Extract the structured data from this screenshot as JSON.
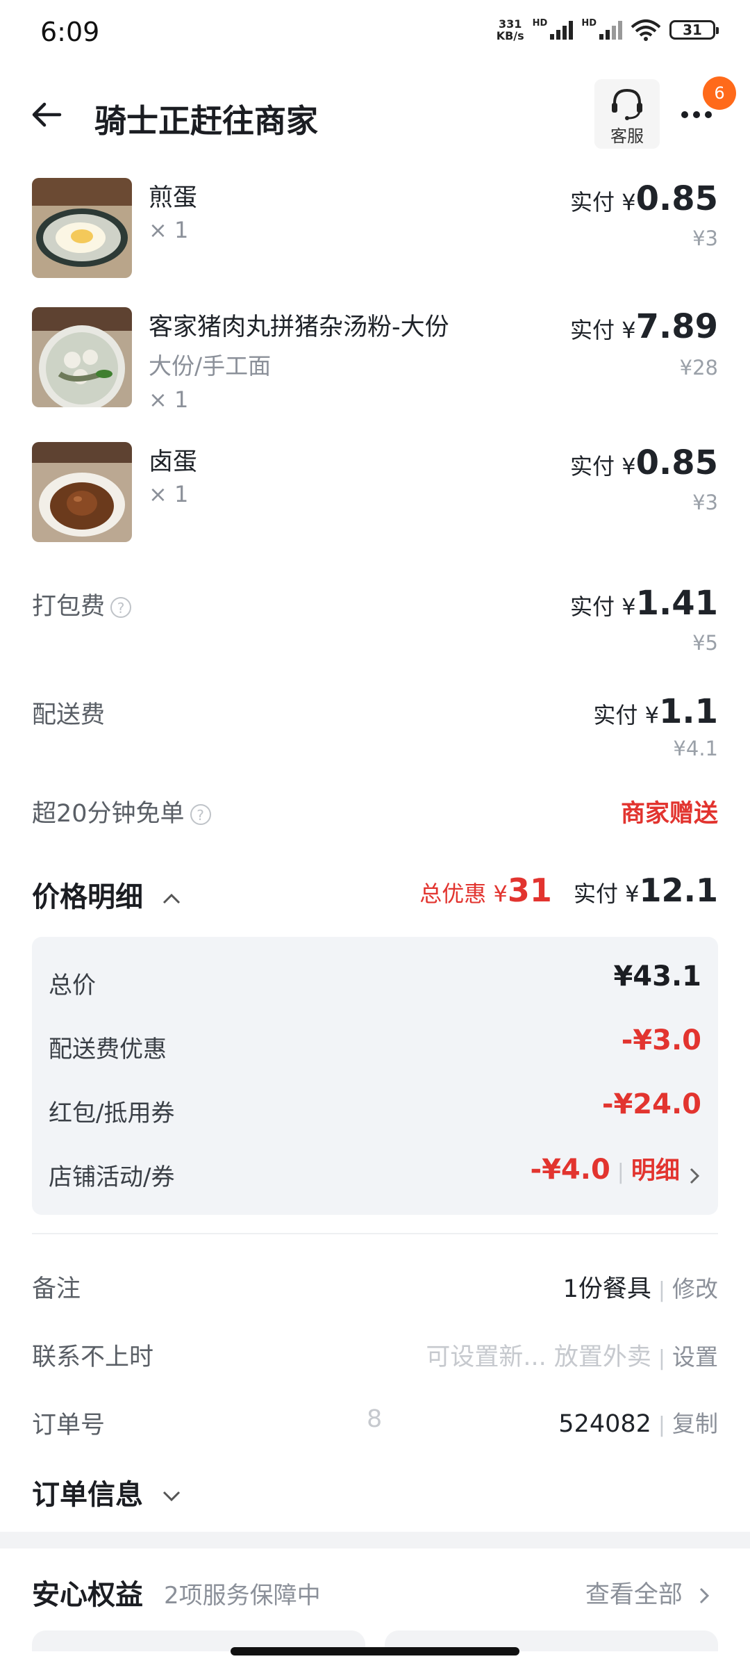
{
  "status_bar": {
    "time": "6:09",
    "net_speed_value": "331",
    "net_speed_unit": "KB/s",
    "hd1": "HD",
    "hd2": "HD",
    "battery": "31"
  },
  "header": {
    "title": "骑士正赶往商家",
    "customer_service_label": "客服",
    "badge_count": "6"
  },
  "items": [
    {
      "name": "煎蛋",
      "spec": "",
      "qty": "× 1",
      "pay_label": "实付 ¥",
      "pay_value": "0.85",
      "original": "¥3"
    },
    {
      "name": "客家猪肉丸拼猪杂汤粉-大份",
      "spec": "大份/手工面",
      "qty": "× 1",
      "pay_label": "实付 ¥",
      "pay_value": "7.89",
      "original": "¥28"
    },
    {
      "name": "卤蛋",
      "spec": "",
      "qty": "× 1",
      "pay_label": "实付 ¥",
      "pay_value": "0.85",
      "original": "¥3"
    }
  ],
  "fees": {
    "packing": {
      "label": "打包费",
      "pay_label": "实付 ¥",
      "pay_value": "1.41",
      "original": "¥5"
    },
    "delivery": {
      "label": "配送费",
      "pay_label": "实付 ¥",
      "pay_value": "1.1",
      "original": "¥4.1"
    },
    "free_order": {
      "label": "超20分钟免单",
      "value": "商家赠送"
    }
  },
  "price_detail": {
    "title": "价格明细",
    "total_discount_label": "总优惠 ¥",
    "total_discount_value": "31",
    "paid_label": "实付 ¥",
    "paid_value": "12.1",
    "rows": [
      {
        "label": "总价",
        "value": "¥43.1"
      },
      {
        "label": "配送费优惠",
        "value": "-¥3.0"
      },
      {
        "label": "红包/抵用券",
        "value": "-¥24.0"
      },
      {
        "label": "店铺活动/券",
        "value": "-¥4.0",
        "link": "明细"
      }
    ]
  },
  "info": {
    "remark": {
      "label": "备注",
      "value": "1份餐具",
      "action": "修改"
    },
    "contact": {
      "label": "联系不上时",
      "value": "可设置新... 放置外卖",
      "action": "设置"
    },
    "order_no": {
      "label": "订单号",
      "value_start": "8",
      "value_end": "524082",
      "action": "复制"
    },
    "order_info_title": "订单信息"
  },
  "assurance": {
    "title": "安心权益",
    "subtitle": "2项服务保障中",
    "view_all": "查看全部"
  },
  "colors": {
    "accent_red": "#e2342f",
    "badge_orange": "#ff6a1a",
    "panel_bg": "#f2f4f7"
  }
}
